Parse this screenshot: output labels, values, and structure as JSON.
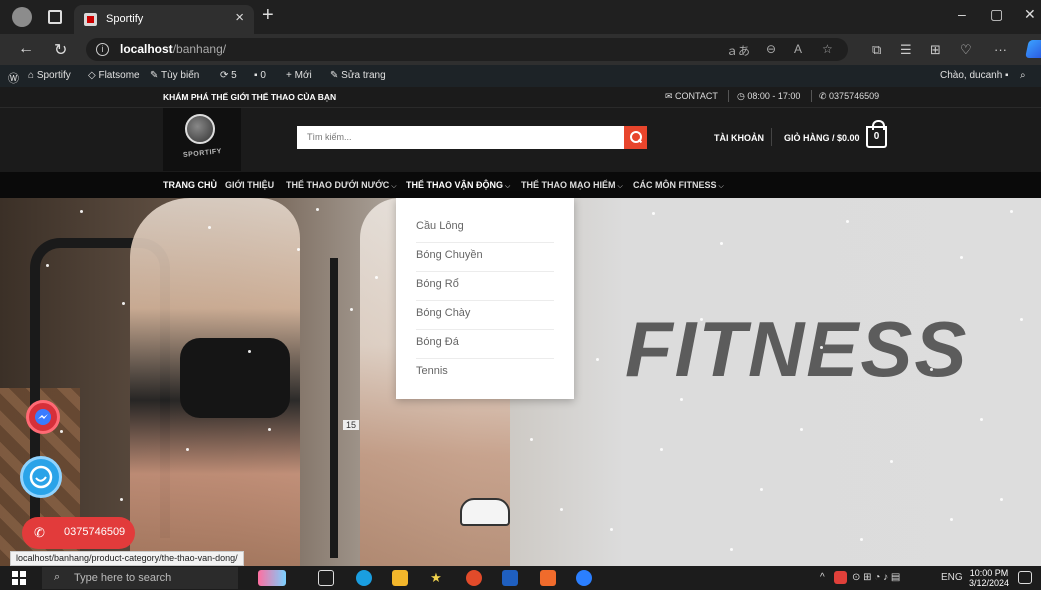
{
  "browser": {
    "tab_title": "Sportify",
    "tab_close": "×",
    "new_tab": "+",
    "url_host": "localhost",
    "url_path": "/banhang/",
    "window_controls": [
      "–",
      "▢",
      "✕"
    ]
  },
  "adminbar": {
    "site": "Sportify",
    "theme": "Flatsome",
    "customize": "Tùy biến",
    "updates": "5",
    "comments": "0",
    "new": "Mới",
    "edit": "Sửa trang",
    "greeting": "Chào, ducanh"
  },
  "topbar": {
    "tagline": "KHÁM PHÁ THẾ GIỚI THỂ THAO CỦA BẠN",
    "contact": "CONTACT",
    "hours": "08:00 - 17:00",
    "phone": "0375746509"
  },
  "header": {
    "logo_text": "SPORTIFY",
    "search_placeholder": "Tìm kiếm...",
    "account": "TÀI KHOẢN",
    "cart": "GIỎ HÀNG / $0.00",
    "cart_count": "0"
  },
  "nav": {
    "items": [
      {
        "label": "TRANG CHỦ",
        "has_dropdown": false
      },
      {
        "label": "GIỚI THIỆU",
        "has_dropdown": false
      },
      {
        "label": "THỂ THAO DƯỚI NƯỚC",
        "has_dropdown": true
      },
      {
        "label": "THỂ THAO VẬN ĐỘNG",
        "has_dropdown": true
      },
      {
        "label": "THỂ THAO MẠO HIỂM",
        "has_dropdown": true
      },
      {
        "label": "CÁC MÔN FITNESS",
        "has_dropdown": true
      }
    ],
    "chevron": "⌵"
  },
  "dropdown": {
    "items": [
      "Cầu Lông",
      "Bóng Chuyền",
      "Bóng Rổ",
      "Bóng Chày",
      "Bóng Đá",
      "Tennis"
    ]
  },
  "hero": {
    "headline": "FITNESS",
    "sign_number": "15"
  },
  "floating": {
    "call_number": "0375746509"
  },
  "status_url": "localhost/banhang/product-category/the-thao-van-dong/",
  "taskbar": {
    "search_placeholder": "Type here to search",
    "lang": "ENG",
    "time": "10:00 PM",
    "date": "3/12/2024"
  },
  "colors": {
    "accent": "#e8452c",
    "call": "#e23b3b",
    "adminbar": "#1d2327"
  }
}
